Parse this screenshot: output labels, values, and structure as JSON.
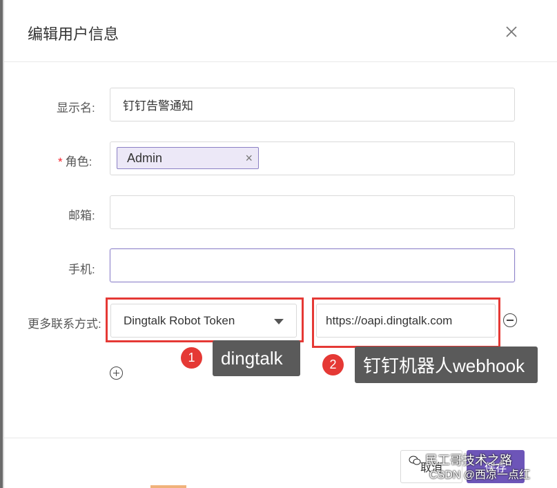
{
  "dialog": {
    "title": "编辑用户信息"
  },
  "fields": {
    "display_name": {
      "label": "显示名:",
      "value": "钉钉告警通知"
    },
    "role": {
      "required_mark": "*",
      "label": "角色:",
      "tag": "Admin",
      "tag_close": "×"
    },
    "email": {
      "label": "邮箱:",
      "value": ""
    },
    "phone": {
      "label": "手机:",
      "value": ""
    },
    "more_contacts": {
      "label": "更多联系方式:",
      "type_selected": "Dingtalk Robot Token",
      "value": "https://oapi.dingtalk.com"
    }
  },
  "annotations": [
    {
      "number": "1",
      "text": "dingtalk"
    },
    {
      "number": "2",
      "text": "钉钉机器人webhook"
    }
  ],
  "footer": {
    "cancel_label": "取消",
    "save_label": "保存"
  },
  "watermark": {
    "line1": "民工哥技术之路",
    "line2": "CSDN @西凉一点红"
  },
  "colors": {
    "accent": "#6d55b8",
    "annotation_red": "#e53935",
    "tooltip_bg": "#5a5a5a"
  }
}
